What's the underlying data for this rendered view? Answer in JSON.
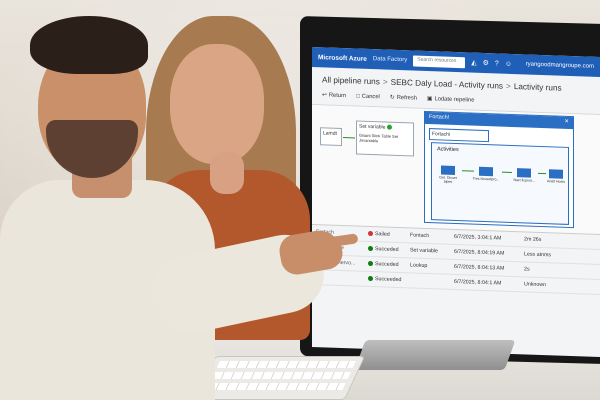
{
  "azure": {
    "brand": "Microsoft Azure",
    "section": "Data Factory",
    "search_placeholder": "Search resources",
    "account": "ryangoodmangroupe.com",
    "icons": [
      "bell-icon",
      "gear-icon",
      "help-icon",
      "smiley-icon"
    ]
  },
  "breadcrumb": {
    "items": [
      "All pipeline runs",
      "SEBC Daly Load - Activity runs",
      "Lactivity runs"
    ]
  },
  "toolbar": {
    "return_label": "Return",
    "cancel_label": "Cancel",
    "refresh_label": "Refresh",
    "update_label": "Lodate repeline"
  },
  "canvas": {
    "lookup_label": "Lamdt",
    "set_variable_label": "Set variable",
    "set_variable_sub": "Gisant Siink Table Set Jovaniable",
    "foreach_panel_title": "Fortach!",
    "foreach_node_label": "Fortachi",
    "activities_label": "Activities",
    "mini_labels": [
      "Get. Diuset bipes",
      "Tres Nnowdpro...",
      "Start ficpnor...",
      "Anibt Hosts"
    ]
  },
  "runs": [
    {
      "name": "Fortach",
      "status": "Sailed",
      "type": "Fontach",
      "time": "6/7/2025, 3:04:1 AM",
      "duration": "2m 26s",
      "status_color": "#d13438"
    },
    {
      "name": "Set variable",
      "status": "Succeded",
      "type": "Set variable",
      "time": "6/7/2025, 8:04:19 AM",
      "duration": "Less atnms",
      "status_color": "#107c10"
    },
    {
      "name": "MBSA Minervo...",
      "status": "Succeded",
      "type": "Lookup",
      "time": "6/7/2025, 8:04:13 AM",
      "duration": "2s",
      "status_color": "#107c10"
    },
    {
      "name": "",
      "status": "Succeeded",
      "type": "",
      "time": "6/7/2025, 8:04:1 AM",
      "duration": "Unknown",
      "status_color": "#107c10"
    }
  ],
  "colors": {
    "azure_blue": "#1f5fb8",
    "panel_blue": "#2a6fc4",
    "success_green": "#107c10",
    "fail_red": "#d13438"
  }
}
